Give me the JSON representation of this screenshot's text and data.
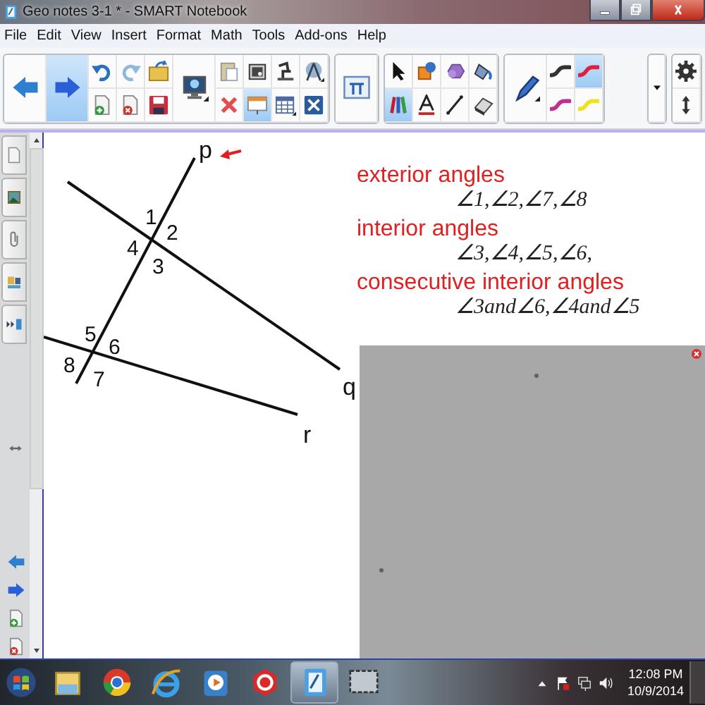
{
  "window": {
    "title": "Geo notes 3-1 * - SMART Notebook"
  },
  "menu": [
    "File",
    "Edit",
    "View",
    "Insert",
    "Format",
    "Math",
    "Tools",
    "Add-ons",
    "Help"
  ],
  "toolbar": [
    {
      "items": [
        {
          "kind": "back",
          "big": true,
          "selected": false
        },
        {
          "kind": "forward",
          "big": true,
          "selected": true
        },
        {
          "kind": "undo",
          "big": false,
          "selected": false
        },
        {
          "kind": "add-page",
          "big": false,
          "selected": false
        },
        {
          "kind": "redo",
          "big": false,
          "selected": false
        },
        {
          "kind": "delete-page",
          "big": false,
          "selected": false
        },
        {
          "kind": "open",
          "big": false,
          "selected": false
        },
        {
          "kind": "save",
          "big": false,
          "selected": false
        },
        {
          "kind": "monitor",
          "big": true,
          "selected": false
        },
        {
          "kind": "paste",
          "big": false,
          "selected": false
        },
        {
          "kind": "delete",
          "big": false,
          "selected": false
        },
        {
          "kind": "camera",
          "big": false,
          "selected": false
        },
        {
          "kind": "screen-shade",
          "big": false,
          "selected": true
        },
        {
          "kind": "document-camera",
          "big": false,
          "selected": false
        },
        {
          "kind": "table",
          "big": false,
          "selected": false
        },
        {
          "kind": "compass",
          "big": false,
          "selected": false
        },
        {
          "kind": "full-screen",
          "big": false,
          "selected": false
        }
      ]
    },
    {
      "items": [
        {
          "kind": "formula",
          "big": true,
          "selected": false
        }
      ]
    },
    {
      "items": [
        {
          "kind": "cursor",
          "big": false,
          "selected": false
        },
        {
          "kind": "pens",
          "big": false,
          "selected": true
        },
        {
          "kind": "shapes",
          "big": false,
          "selected": false
        },
        {
          "kind": "text",
          "big": false,
          "selected": false
        },
        {
          "kind": "magic-pen",
          "big": false,
          "selected": false
        },
        {
          "kind": "line",
          "big": false,
          "selected": false
        },
        {
          "kind": "fill",
          "big": false,
          "selected": false
        },
        {
          "kind": "eraser",
          "big": false,
          "selected": false
        }
      ]
    },
    {
      "items": [
        {
          "kind": "pen",
          "big": true,
          "selected": false
        },
        {
          "kind": "stroke",
          "color": "#333333",
          "big": false,
          "selected": false
        },
        {
          "kind": "stroke",
          "color": "#c03090",
          "big": false,
          "selected": false
        },
        {
          "kind": "stroke",
          "color": "#e02040",
          "big": false,
          "selected": true
        },
        {
          "kind": "stroke",
          "color": "#f0e020",
          "big": false,
          "selected": false
        }
      ]
    },
    {
      "spacer": true,
      "items": [
        {
          "kind": "dropdown",
          "big": true,
          "selected": false
        }
      ]
    },
    {
      "items": [
        {
          "kind": "gear",
          "big": false,
          "selected": false
        },
        {
          "kind": "resize",
          "big": false,
          "selected": false
        }
      ]
    }
  ],
  "sidebar": {
    "tabs": [
      {
        "kind": "page"
      },
      {
        "kind": "picture"
      },
      {
        "kind": "paperclip"
      },
      {
        "kind": "properties"
      },
      {
        "kind": "addons"
      }
    ],
    "bottom": [
      {
        "kind": "swap"
      },
      {
        "kind": "back"
      },
      {
        "kind": "forward"
      },
      {
        "kind": "add-page"
      },
      {
        "kind": "delete-page"
      }
    ]
  },
  "diagram": {
    "labels": [
      "p",
      "1",
      "2",
      "4",
      "3",
      "5",
      "6",
      "8",
      "7",
      "q",
      "r"
    ]
  },
  "notes": [
    {
      "heading": "exterior angles",
      "angles": "∠1,∠2,∠7,∠8"
    },
    {
      "heading": "interior angles",
      "angles": "∠3,∠4,∠5,∠6,"
    },
    {
      "heading": "consecutive interior angles",
      "angles": "∠3and∠6,∠4and∠5"
    }
  ],
  "taskbar": {
    "apps": [
      {
        "kind": "start",
        "active": false
      },
      {
        "kind": "folder",
        "active": false
      },
      {
        "kind": "browser",
        "active": false
      },
      {
        "kind": "web-e",
        "active": false
      },
      {
        "kind": "media",
        "active": false
      },
      {
        "kind": "hexagon",
        "active": false
      },
      {
        "kind": "notebook",
        "active": true
      },
      {
        "kind": "capture",
        "active": false
      }
    ],
    "tray": [
      {
        "kind": "tray-arrow"
      },
      {
        "kind": "flag"
      },
      {
        "kind": "network"
      },
      {
        "kind": "speaker"
      }
    ],
    "time": "12:08 PM",
    "date": "10/9/2014"
  }
}
